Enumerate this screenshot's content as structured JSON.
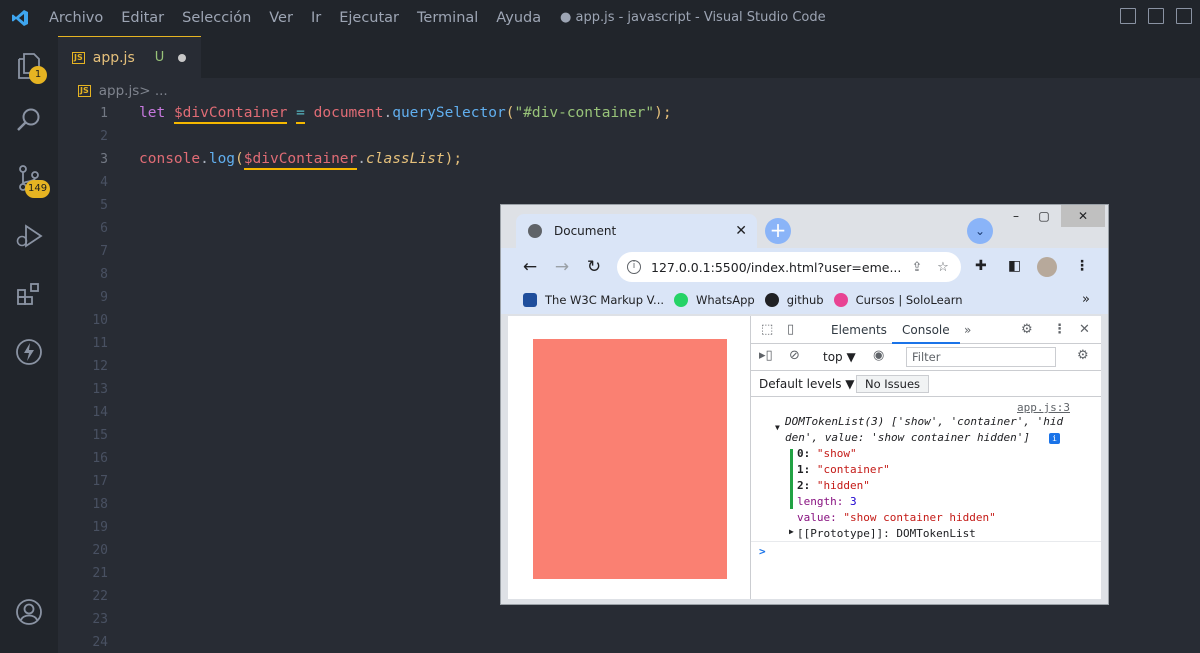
{
  "titlebar": {
    "menu": [
      "Archivo",
      "Editar",
      "Selección",
      "Ver",
      "Ir",
      "Ejecutar",
      "Terminal",
      "Ayuda"
    ],
    "title": "● app.js - javascript - Visual Studio Code"
  },
  "activity": {
    "explorer_badge": "1",
    "scm_badge": "149"
  },
  "editor": {
    "tab_name": "app.js",
    "tab_status": "U",
    "breadcrumb_file": "app.js",
    "breadcrumb_sep": " > ...",
    "line_numbers": [
      "1",
      "2",
      "3",
      "4",
      "5",
      "6",
      "7",
      "8",
      "9",
      "10",
      "11",
      "12",
      "13",
      "14",
      "15",
      "16",
      "17",
      "18",
      "19",
      "20",
      "21",
      "22",
      "23",
      "24"
    ],
    "line1": {
      "kw": "let",
      "var": "$divContainer",
      "op": "=",
      "obj": "document",
      "dot": ".",
      "fn": "querySelector",
      "open": "(",
      "str": "\"#div-container\"",
      "close": ");"
    },
    "line3": {
      "obj": "console",
      "dot": ".",
      "fn": "log",
      "open": "(",
      "var": "$divContainer",
      "dot2": ".",
      "prop": "classList",
      "close": ");"
    }
  },
  "browser": {
    "tab_title": "Document",
    "tab_close": "✕",
    "new_tab": "+",
    "tab_search": "⌄",
    "win_min": "–",
    "win_max": "▢",
    "win_close": "✕",
    "url": "127.0.0.1:5500/index.html?user=eme...",
    "bookmarks": [
      {
        "label": "The W3C Markup V...",
        "color": "#1f4e9c"
      },
      {
        "label": "WhatsApp",
        "color": "#25d366"
      },
      {
        "label": "github",
        "color": "#202124"
      },
      {
        "label": "Cursos | SoloLearn",
        "color": "#e84393"
      }
    ],
    "bookmarks_more": "»",
    "box_color": "#fa8072"
  },
  "devtools": {
    "tab_elements": "Elements",
    "tab_console": "Console",
    "tab_more": "»",
    "context": "top ▼",
    "filter_placeholder": "Filter",
    "default_levels": "Default levels ▼",
    "no_issues": "No Issues",
    "source_link": "app.js:3",
    "log_line1": "DOMTokenList(3) ['show', 'container', 'hid",
    "log_line2": "den', value: 'show container hidden']",
    "info_badge": "i",
    "entries": [
      {
        "key": "0:",
        "val": "\"show\""
      },
      {
        "key": "1:",
        "val": "\"container\""
      },
      {
        "key": "2:",
        "val": "\"hidden\""
      }
    ],
    "length_key": "length:",
    "length_val": "3",
    "value_key": "value:",
    "value_val": "\"show container hidden\"",
    "prototype": "[[Prototype]]: DOMTokenList",
    "prompt": ">"
  }
}
